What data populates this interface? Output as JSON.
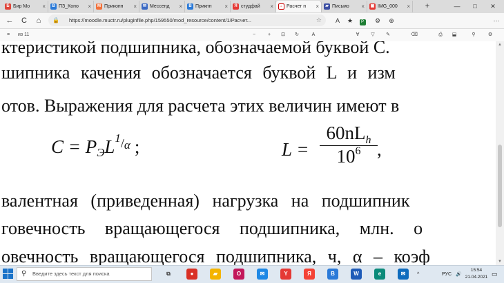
{
  "browser": {
    "tabs": [
      {
        "label": "Бир Мо",
        "icon_color": "#e0463b",
        "icon_glyph": "Б",
        "icon": "app-icon"
      },
      {
        "label": "ПЗ_Коно",
        "icon_color": "#2b7ad8",
        "icon_glyph": "В",
        "icon": "vk-icon"
      },
      {
        "label": "Прикопн",
        "icon_color": "#f2713b",
        "icon_glyph": "M",
        "icon": "moodle-icon"
      },
      {
        "label": "Мессенд",
        "icon_color": "#3a69c4",
        "icon_glyph": "✉",
        "icon": "messenger-icon"
      },
      {
        "label": "Прикпн",
        "icon_color": "#2b7ad8",
        "icon_glyph": "В",
        "icon": "vk-icon"
      },
      {
        "label": "студфай",
        "icon_color": "#e53935",
        "icon_glyph": "Я",
        "icon": "yandex-icon"
      },
      {
        "label": "Расчет п",
        "icon_color": "#ffffff",
        "icon_glyph": "▫",
        "icon": "pdf-icon",
        "active": true
      },
      {
        "label": "Письмо",
        "icon_color": "#3c4fa3",
        "icon_glyph": "▰",
        "icon": "mail-icon"
      },
      {
        "label": "IMG_000",
        "icon_color": "#e53935",
        "icon_glyph": "▣",
        "icon": "image-icon"
      }
    ],
    "new_tab": "+",
    "window_buttons": [
      "—",
      "□",
      "✕"
    ],
    "nav": {
      "back": "←",
      "refresh": "C",
      "home": "⌂"
    },
    "url": "https://moodle.muctr.ru/pluginfile.php/159550/mod_resource/content/1/Расчет...",
    "lock": "🔒",
    "star": "☆",
    "toolbar_icons": [
      "A",
      "★",
      "P",
      "⚙",
      "⊕",
      "⋯"
    ]
  },
  "pdf_toolbar": {
    "menu": "≡",
    "page": "из 11",
    "zoom_out": "−",
    "zoom_in": "+",
    "fit": "⊡",
    "rotate": "↻",
    "read_aloud": "A",
    "tools": [
      "∀",
      "▽",
      "✎",
      "⌫",
      "⎙",
      "⬓",
      "⚲",
      "⚙"
    ]
  },
  "document": {
    "lines": [
      "ктеристикой подшипника, обозначаемой буквой C.",
      "шипника качения обозначается буквой L и изм",
      "отов. Выражения для расчета этих величин имеют в",
      "валентная (приведенная) нагрузка на подшипник",
      "говечность вращающегося подшипника, млн. о",
      "овечность вращающегося подшипника, ч, α – коэф"
    ],
    "formula1": {
      "left": "C = P",
      "sub": "Э",
      "mid": "L",
      "exp_num": "1",
      "exp_den": "α",
      "end": ";"
    },
    "formula2": {
      "left": "L =",
      "num": "60nL",
      "num_sub": "h",
      "den": "10",
      "den_exp": "6",
      "end": ","
    }
  },
  "taskbar": {
    "search_placeholder": "Введите здесь текст для поиска",
    "apps": [
      {
        "name": "task-view",
        "glyph": "⧉",
        "color": "#444444"
      },
      {
        "name": "chrome",
        "glyph": "●",
        "color": "#d93025"
      },
      {
        "name": "file-explorer",
        "glyph": "▰",
        "color": "#f4b400"
      },
      {
        "name": "opera",
        "glyph": "O",
        "color": "#c2185b"
      },
      {
        "name": "mail",
        "glyph": "✉",
        "color": "#1e88e5"
      },
      {
        "name": "yandex",
        "glyph": "Y",
        "color": "#e53935"
      },
      {
        "name": "yandex-browser",
        "glyph": "Я",
        "color": "#f44336"
      },
      {
        "name": "vk",
        "glyph": "B",
        "color": "#2b7ad8"
      },
      {
        "name": "word",
        "glyph": "W",
        "color": "#1e5bb8"
      },
      {
        "name": "edge",
        "glyph": "e",
        "color": "#0b8a7a"
      },
      {
        "name": "outlook",
        "glyph": "✉",
        "color": "#0f6cbd"
      }
    ],
    "tray": {
      "arrow": "^",
      "lang": "РУС",
      "volume": "🔊"
    },
    "time": "15:54",
    "date": "21.04.2021",
    "notif": "▭"
  }
}
